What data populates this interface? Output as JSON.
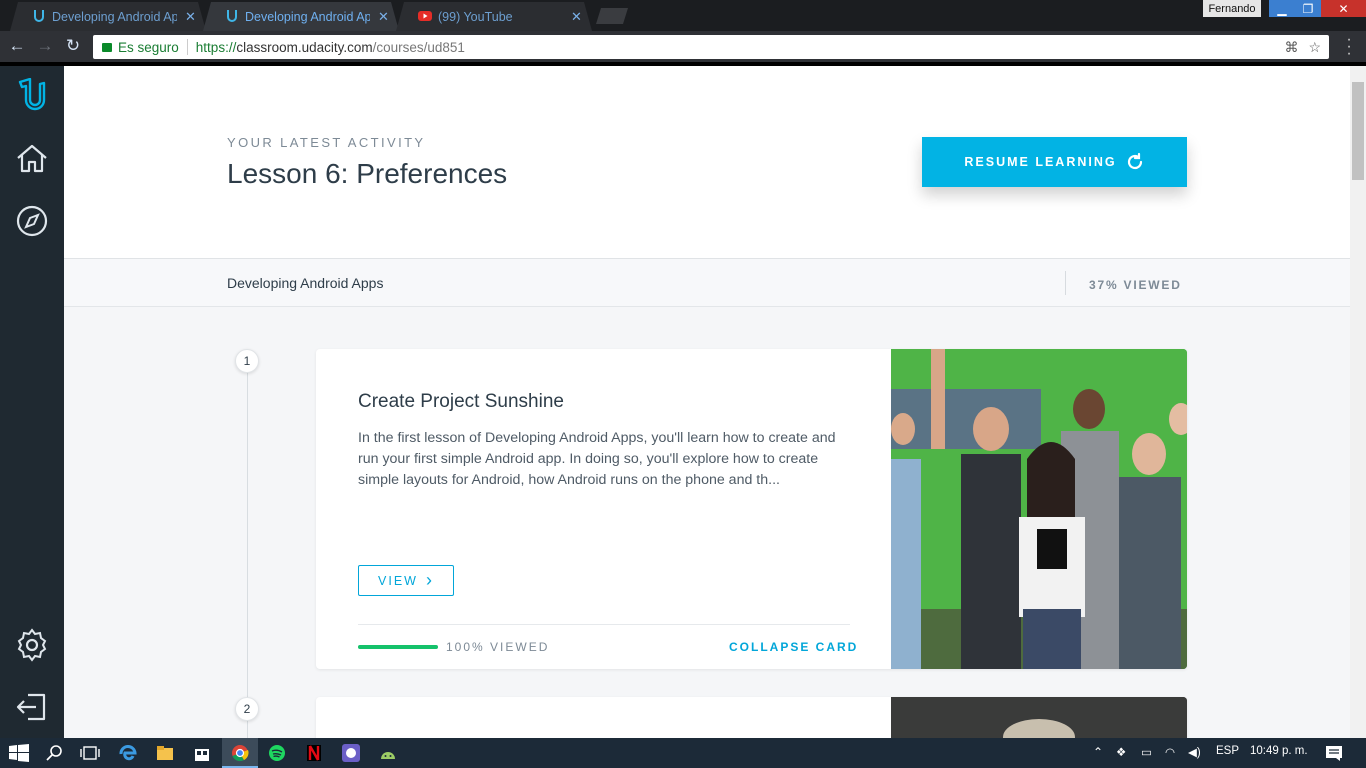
{
  "browser": {
    "tabs": [
      {
        "label": "Developing Android App",
        "icon": "udacity-icon",
        "active": false
      },
      {
        "label": "Developing Android App",
        "icon": "udacity-icon",
        "active": true
      },
      {
        "label": "(99) YouTube",
        "icon": "youtube-icon",
        "active": false
      }
    ],
    "profile_name": "Fernando",
    "security_label": "Es seguro",
    "url_prefix": "https://",
    "url_host": "classroom.udacity.com",
    "url_path": "/courses/ud851"
  },
  "sidebar": {
    "items": [
      {
        "icon": "udacity-logo-icon"
      },
      {
        "icon": "home-icon"
      },
      {
        "icon": "compass-icon"
      },
      {
        "icon": "gear-icon"
      },
      {
        "icon": "logout-icon"
      }
    ]
  },
  "header": {
    "kicker": "YOUR LATEST ACTIVITY",
    "lesson_title": "Lesson 6: Preferences",
    "resume_label": "RESUME LEARNING"
  },
  "course": {
    "name": "Developing Android Apps",
    "viewed_label": "37% VIEWED"
  },
  "lessons": [
    {
      "number": "1",
      "title": "Create Project Sunshine",
      "description": "In the first lesson of Developing Android Apps, you'll learn how to create and run your first simple Android app. In doing so, you'll explore how to create simple layouts for Android, how Android runs on the phone and th...",
      "view_label": "VIEW",
      "progress": 1.0,
      "progress_label": "100% VIEWED",
      "collapse_label": "COLLAPSE CARD"
    },
    {
      "number": "2"
    }
  ],
  "taskbar": {
    "language": "ESP",
    "time": "10:49 p. m."
  },
  "colors": {
    "accent": "#02b3e4",
    "sidebar": "#1f2931",
    "progress": "#15c26b",
    "text": "#2e3d49"
  }
}
